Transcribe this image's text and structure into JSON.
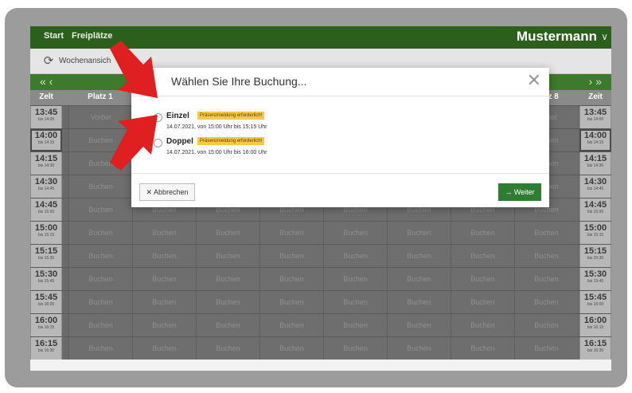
{
  "nav": {
    "start": "Start",
    "freiplaetze": "Freiplätze",
    "user": "Mustermann",
    "user_chevron": "∨"
  },
  "toolbar": {
    "week_icon": "⟳",
    "week_label": "Wochenansich"
  },
  "datebar": {
    "prev": "« ‹",
    "next": "› »"
  },
  "header": {
    "zeit_left": "Zelt",
    "platz1": "Platz 1",
    "platz8": "Platz 8",
    "zeit_right": "Zeit"
  },
  "rows": [
    {
      "time": "13:45",
      "sub": "bis 14:00",
      "slots": [
        "Vorbei",
        "",
        "",
        "",
        "",
        "",
        "",
        "Vorbei"
      ]
    },
    {
      "time": "14:00",
      "sub": "bis 14:15",
      "slots": [
        "Buchen",
        "",
        "",
        "",
        "",
        "",
        "",
        "Buchen"
      ],
      "highlight": true
    },
    {
      "time": "14:15",
      "sub": "bis 14:30",
      "slots": [
        "Buchen",
        "",
        "",
        "",
        "",
        "",
        "",
        "Buchen"
      ]
    },
    {
      "time": "14:30",
      "sub": "bis 14:45",
      "slots": [
        "Buchen",
        "Buchen",
        "Buchen",
        "Buchen",
        "Buchen",
        "Buchen",
        "Buchen",
        "Buchen"
      ]
    },
    {
      "time": "14:45",
      "sub": "bis 15:00",
      "slots": [
        "Buchen",
        "Buchen",
        "Buchen",
        "Buchen",
        "Buchen",
        "Buchen",
        "Buchen",
        "Buchen"
      ]
    },
    {
      "time": "15:00",
      "sub": "bis 15:15",
      "slots": [
        "Buchen",
        "Buchen",
        "Buchen",
        "Buchen",
        "Buchen",
        "Buchen",
        "Buchen",
        "Buchen"
      ]
    },
    {
      "time": "15:15",
      "sub": "bis 15:30",
      "slots": [
        "Buchen",
        "Buchen",
        "Buchen",
        "Buchen",
        "Buchen",
        "Buchen",
        "Buchen",
        "Buchen"
      ]
    },
    {
      "time": "15:30",
      "sub": "bis 15:45",
      "slots": [
        "Buchen",
        "Buchen",
        "Buchen",
        "Buchen",
        "Buchen",
        "Buchen",
        "Buchen",
        "Buchen"
      ]
    },
    {
      "time": "15:45",
      "sub": "bis 16:00",
      "slots": [
        "Buchen",
        "Buchen",
        "Buchen",
        "Buchen",
        "Buchen",
        "Buchen",
        "Buchen",
        "Buchen"
      ]
    },
    {
      "time": "16:00",
      "sub": "bis 16:15",
      "slots": [
        "Buchen",
        "Buchen",
        "Buchen",
        "Buchen",
        "Buchen",
        "Buchen",
        "Buchen",
        "Buchen"
      ]
    },
    {
      "time": "16:15",
      "sub": "bis 16:30",
      "slots": [
        "Buchen",
        "Buchen",
        "Buchen",
        "Buchen",
        "Buchen",
        "Buchen",
        "Buchen",
        "Buchen"
      ]
    }
  ],
  "modal": {
    "title": "Wählen Sie Ihre Buchung...",
    "close": "✕",
    "options": [
      {
        "name": "Einzel",
        "badge": "Präsenzmeldung erforderlich!",
        "when": "14.07.2021, von 15:00 Uhr bis 15:15 Uhr"
      },
      {
        "name": "Doppel",
        "badge": "Präsenzmeldung erforderlich!",
        "when": "14.07.2021, von 15:00 Uhr bis 16:00 Uhr"
      }
    ],
    "cancel": "✕ Abbrechen",
    "next": "→ Weiter"
  },
  "colors": {
    "brand_green": "#2d5f1c",
    "button_green": "#2e7d32",
    "badge_yellow": "#f7c94a",
    "arrow_red": "#e02020"
  }
}
